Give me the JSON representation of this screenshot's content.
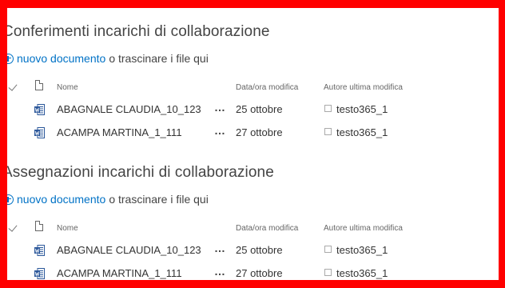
{
  "colors": {
    "frame": "#ff0000",
    "link": "#0072c6"
  },
  "sections": [
    {
      "title": "Conferimenti incarichi di collaborazione",
      "new_doc_label": "nuovo documento",
      "drag_text": "o trascinare i file qui",
      "columns": {
        "name": "Nome",
        "modified": "Data/ora modifica",
        "author": "Autore ultima modifica"
      },
      "files": [
        {
          "name": "ABAGNALE CLAUDIA_10_123",
          "actions": "…",
          "modified": "25 ottobre",
          "author": "testo365_1",
          "icon": "word-document-icon"
        },
        {
          "name": "ACAMPA MARTINA_1_111",
          "actions": "…",
          "modified": "27 ottobre",
          "author": "testo365_1",
          "icon": "word-document-icon"
        }
      ]
    },
    {
      "title": "Assegnazioni incarichi di collaborazione",
      "new_doc_label": "nuovo documento",
      "drag_text": "o trascinare i file qui",
      "columns": {
        "name": "Nome",
        "modified": "Data/ora modifica",
        "author": "Autore ultima modifica"
      },
      "files": [
        {
          "name": "ABAGNALE CLAUDIA_10_123",
          "actions": "…",
          "modified": "25 ottobre",
          "author": "testo365_1",
          "icon": "word-document-icon"
        },
        {
          "name": "ACAMPA MARTINA_1_111",
          "actions": "…",
          "modified": "27 ottobre",
          "author": "testo365_1",
          "icon": "word-document-icon"
        }
      ]
    }
  ]
}
